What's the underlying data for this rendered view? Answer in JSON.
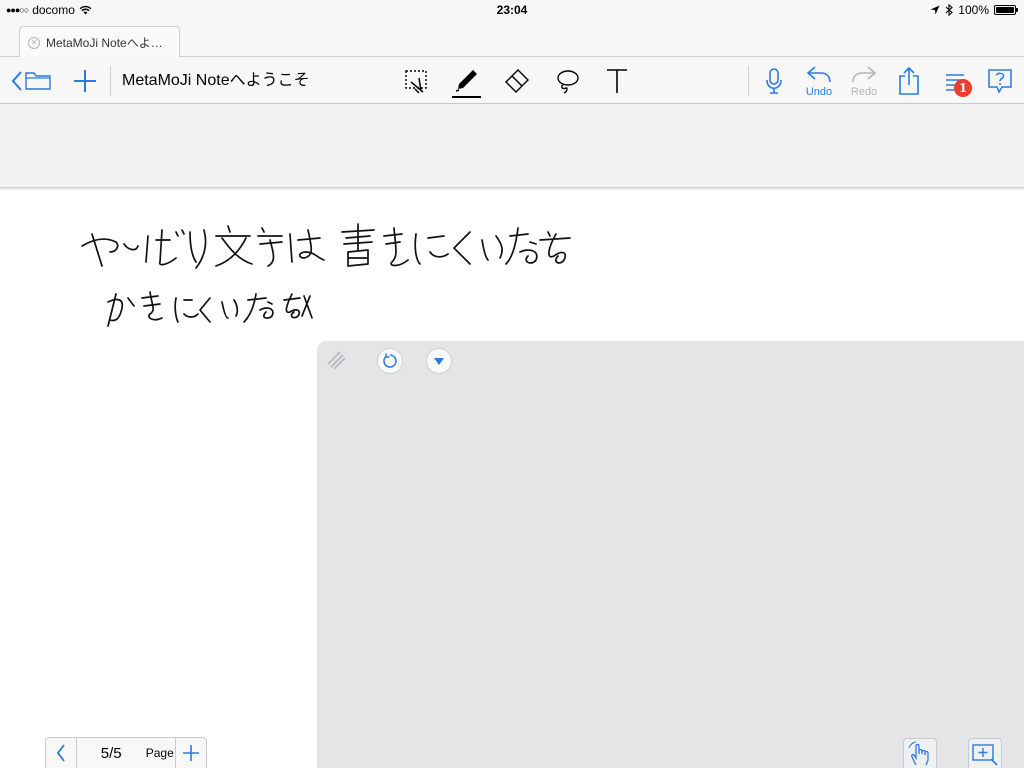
{
  "status_bar": {
    "signal_dots": "●●●○○",
    "carrier": "docomo",
    "time": "23:04",
    "battery": "100%"
  },
  "tab": {
    "title": "MetaMoJi Noteへよ…"
  },
  "toolbar": {
    "document_title": "MetaMoJi Noteへようこそ",
    "undo_label": "Undo",
    "redo_label": "Redo",
    "notification_count": "1"
  },
  "handwriting": {
    "line1": "やっぱり文字は書きにくいなあ",
    "line2": "かきにくいなあ"
  },
  "page_nav": {
    "current": "5/5",
    "label": "Page"
  },
  "colors": {
    "accent": "#2a7ae2",
    "disabled": "#b3b3b3",
    "badge": "#f03b2f",
    "panel": "#e4e5e6"
  },
  "icons": {
    "back": "chevron-left-icon",
    "folder": "folder-icon",
    "add": "plus-icon",
    "select": "select-tool-icon",
    "pen": "pen-icon",
    "eraser": "eraser-icon",
    "lasso": "lasso-icon",
    "text": "text-tool-icon",
    "mic": "microphone-icon",
    "undo": "undo-icon",
    "redo": "redo-icon",
    "share": "share-icon",
    "list": "list-icon",
    "help": "help-icon"
  }
}
